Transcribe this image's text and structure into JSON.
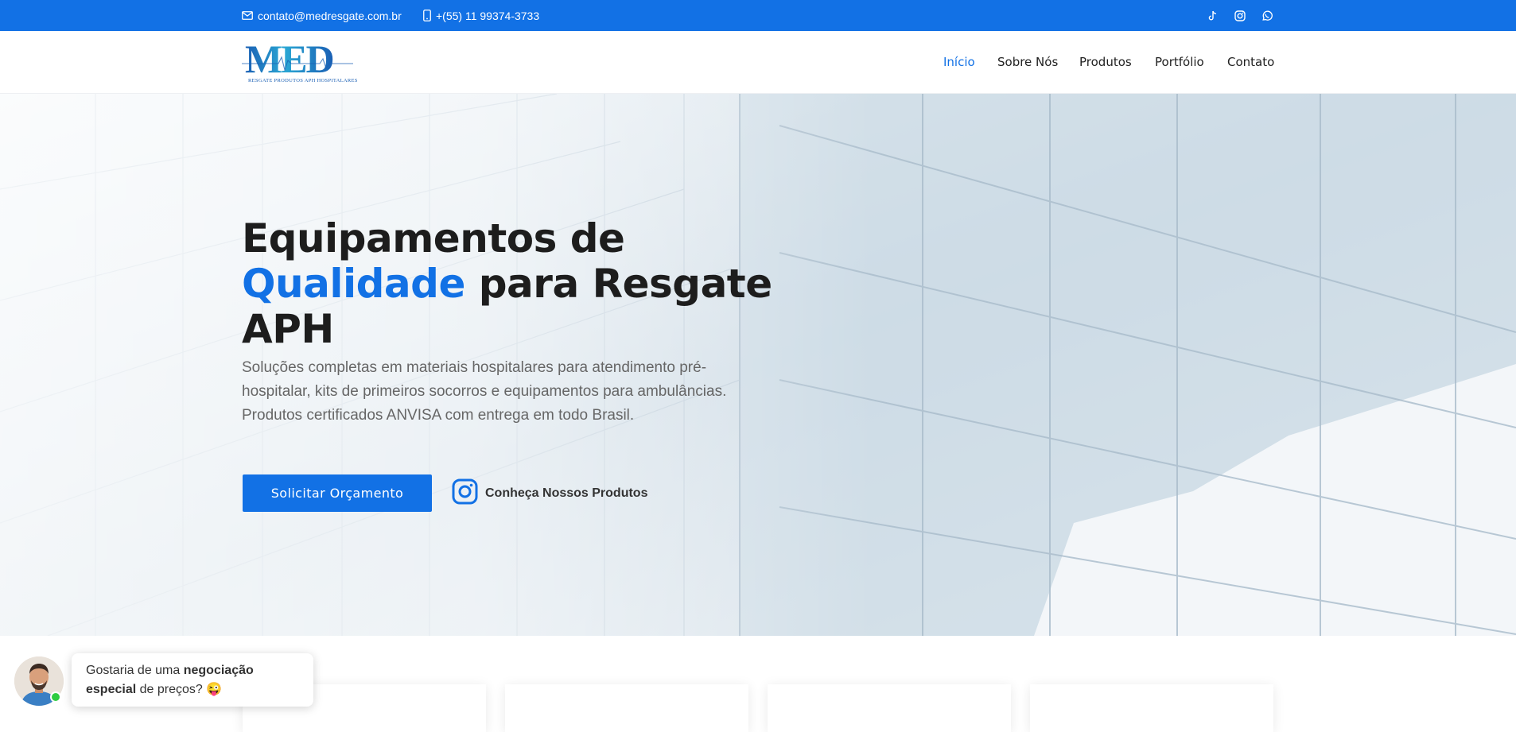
{
  "topbar": {
    "email": "contato@medresgate.com.br",
    "phone": "+(55) 11 99374-3733",
    "social": [
      "tiktok-icon",
      "instagram-icon",
      "whatsapp-icon"
    ]
  },
  "logo": {
    "word": "MED",
    "tagline": "RESGATE PRODUTOS APH HOSPITALARES"
  },
  "nav": {
    "items": [
      {
        "label": "Início",
        "active": true
      },
      {
        "label": "Sobre Nós",
        "active": false
      },
      {
        "label": "Produtos",
        "active": false
      },
      {
        "label": "Portfólio",
        "active": false
      },
      {
        "label": "Contato",
        "active": false
      }
    ]
  },
  "hero": {
    "title_line1": "Equipamentos de",
    "title_highlight": "Qualidade",
    "title_rest": " para Resgate APH",
    "lead": "Soluções completas em materiais hospitalares para atendimento pré-hospitalar, kits de primeiros socorros e equipamentos para ambulâncias. Produtos certificados ANVISA com entrega em todo Brasil.",
    "cta_primary": "Solicitar Orçamento",
    "cta_secondary": "Conheça Nossos Produtos"
  },
  "chat": {
    "pre": "Gostaria de uma ",
    "bold": "negociação especial",
    "post": " de preços? 😜"
  },
  "colors": {
    "brand": "#1271e5",
    "text": "#1d1d1d",
    "muted": "#666666"
  }
}
